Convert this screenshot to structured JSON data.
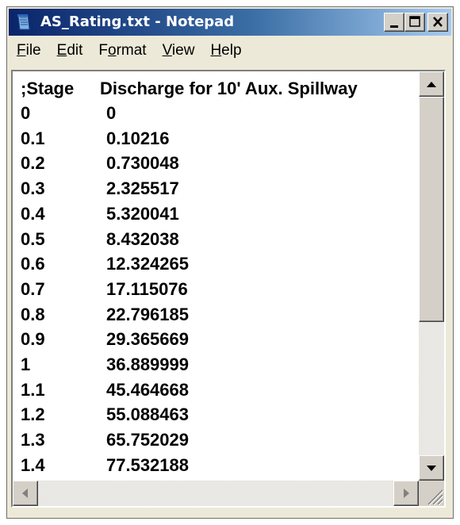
{
  "window": {
    "title": "AS_Rating.txt - Notepad"
  },
  "menu": [
    {
      "acc": "F",
      "rest": "ile"
    },
    {
      "acc": "E",
      "rest": "dit"
    },
    {
      "pre": "F",
      "acc": "o",
      "rest": "rmat"
    },
    {
      "acc": "V",
      "rest": "iew"
    },
    {
      "acc": "H",
      "rest": "elp"
    }
  ],
  "document": {
    "header": {
      "stage": ";Stage",
      "discharge": "Discharge for 10' Aux. Spillway"
    },
    "rows": [
      {
        "stage": "0",
        "discharge": "0"
      },
      {
        "stage": "0.1",
        "discharge": "0.10216"
      },
      {
        "stage": "0.2",
        "discharge": "0.730048"
      },
      {
        "stage": "0.3",
        "discharge": "2.325517"
      },
      {
        "stage": "0.4",
        "discharge": "5.320041"
      },
      {
        "stage": "0.5",
        "discharge": "8.432038"
      },
      {
        "stage": "0.6",
        "discharge": "12.324265"
      },
      {
        "stage": "0.7",
        "discharge": "17.115076"
      },
      {
        "stage": "0.8",
        "discharge": "22.796185"
      },
      {
        "stage": "0.9",
        "discharge": "29.365669"
      },
      {
        "stage": "1",
        "discharge": "36.889999"
      },
      {
        "stage": "1.1",
        "discharge": "45.464668"
      },
      {
        "stage": "1.2",
        "discharge": "55.088463"
      },
      {
        "stage": "1.3",
        "discharge": "65.752029"
      },
      {
        "stage": "1.4",
        "discharge": "77.532188"
      }
    ]
  },
  "icons": {
    "app": "notepad-icon",
    "minimize": "minimize-icon",
    "maximize": "maximize-icon",
    "close": "close-icon",
    "scroll_up": "arrow-up-icon",
    "scroll_down": "arrow-down-icon",
    "scroll_left": "arrow-left-icon",
    "scroll_right": "arrow-right-icon"
  },
  "colors": {
    "title_gradient_start": "#0a246a",
    "title_gradient_end": "#a6caf0",
    "chrome": "#ece9d8"
  }
}
